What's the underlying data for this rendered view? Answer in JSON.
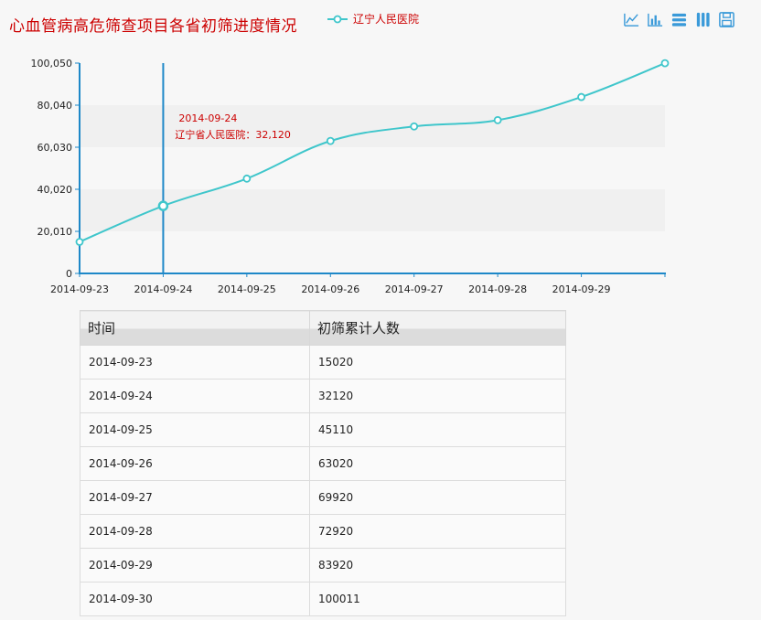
{
  "title": "心血管病高危筛查项目各省初筛进度情况",
  "legend": {
    "series_name": "辽宁人民医院"
  },
  "toolbox": [
    {
      "name": "line-chart-icon"
    },
    {
      "name": "bar-chart-icon"
    },
    {
      "name": "stack-icon"
    },
    {
      "name": "tiled-icon"
    },
    {
      "name": "save-icon"
    }
  ],
  "colors": {
    "series": "#3fc6cb",
    "axis": "#1e88c8",
    "title": "#cc0000",
    "toolbox": "#3a9ad9"
  },
  "tooltip": {
    "date": "2014-09-24",
    "text": "辽宁省人民医院：32,120"
  },
  "chart_data": {
    "type": "line",
    "x": [
      "2014-09-23",
      "2014-09-24",
      "2014-09-25",
      "2014-09-26",
      "2014-09-27",
      "2014-09-28",
      "2014-09-29",
      "2014-09-30"
    ],
    "x_tick_labels": [
      "2014-09-23",
      "2014-09-24",
      "2014-09-25",
      "2014-09-26",
      "2014-09-27",
      "2014-09-28",
      "2014-09-29"
    ],
    "series": [
      {
        "name": "辽宁人民医院",
        "values": [
          15020,
          32120,
          45110,
          63020,
          69920,
          72920,
          83920,
          100011
        ]
      }
    ],
    "y_ticks": [
      "0",
      "20,010",
      "40,020",
      "60,030",
      "80,040",
      "100,050"
    ],
    "ylim": [
      0,
      100050
    ],
    "grid": "horizontal-bands",
    "legend_position": "top",
    "highlight_index": 1
  },
  "table": {
    "headers": [
      "时间",
      "初筛累计人数"
    ],
    "rows": [
      [
        "2014-09-23",
        "15020"
      ],
      [
        "2014-09-24",
        "32120"
      ],
      [
        "2014-09-25",
        "45110"
      ],
      [
        "2014-09-26",
        "63020"
      ],
      [
        "2014-09-27",
        "69920"
      ],
      [
        "2014-09-28",
        "72920"
      ],
      [
        "2014-09-29",
        "83920"
      ],
      [
        "2014-09-30",
        "100011"
      ]
    ]
  }
}
